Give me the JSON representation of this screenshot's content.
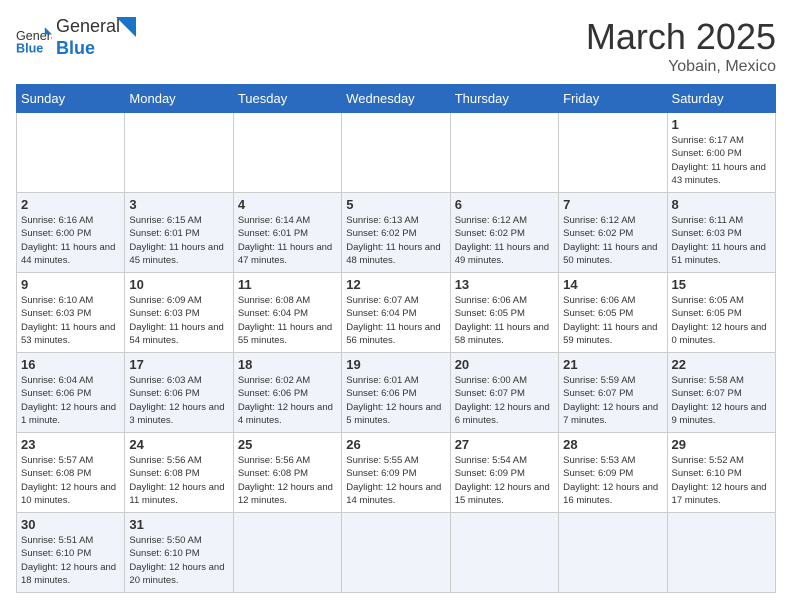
{
  "header": {
    "logo_text_normal": "General",
    "logo_text_blue": "Blue",
    "month_title": "March 2025",
    "subtitle": "Yobain, Mexico"
  },
  "days_of_week": [
    "Sunday",
    "Monday",
    "Tuesday",
    "Wednesday",
    "Thursday",
    "Friday",
    "Saturday"
  ],
  "weeks": [
    [
      null,
      null,
      null,
      null,
      null,
      null,
      {
        "day": 1,
        "sunrise": "6:17 AM",
        "sunset": "6:00 PM",
        "daylight": "11 hours and 43 minutes."
      }
    ],
    [
      {
        "day": 2,
        "sunrise": "6:16 AM",
        "sunset": "6:00 PM",
        "daylight": "11 hours and 44 minutes."
      },
      {
        "day": 3,
        "sunrise": "6:15 AM",
        "sunset": "6:01 PM",
        "daylight": "11 hours and 45 minutes."
      },
      {
        "day": 4,
        "sunrise": "6:14 AM",
        "sunset": "6:01 PM",
        "daylight": "11 hours and 47 minutes."
      },
      {
        "day": 5,
        "sunrise": "6:13 AM",
        "sunset": "6:02 PM",
        "daylight": "11 hours and 48 minutes."
      },
      {
        "day": 6,
        "sunrise": "6:12 AM",
        "sunset": "6:02 PM",
        "daylight": "11 hours and 49 minutes."
      },
      {
        "day": 7,
        "sunrise": "6:12 AM",
        "sunset": "6:02 PM",
        "daylight": "11 hours and 50 minutes."
      },
      {
        "day": 8,
        "sunrise": "6:11 AM",
        "sunset": "6:03 PM",
        "daylight": "11 hours and 51 minutes."
      }
    ],
    [
      {
        "day": 9,
        "sunrise": "6:10 AM",
        "sunset": "6:03 PM",
        "daylight": "11 hours and 53 minutes."
      },
      {
        "day": 10,
        "sunrise": "6:09 AM",
        "sunset": "6:03 PM",
        "daylight": "11 hours and 54 minutes."
      },
      {
        "day": 11,
        "sunrise": "6:08 AM",
        "sunset": "6:04 PM",
        "daylight": "11 hours and 55 minutes."
      },
      {
        "day": 12,
        "sunrise": "6:07 AM",
        "sunset": "6:04 PM",
        "daylight": "11 hours and 56 minutes."
      },
      {
        "day": 13,
        "sunrise": "6:06 AM",
        "sunset": "6:05 PM",
        "daylight": "11 hours and 58 minutes."
      },
      {
        "day": 14,
        "sunrise": "6:06 AM",
        "sunset": "6:05 PM",
        "daylight": "11 hours and 59 minutes."
      },
      {
        "day": 15,
        "sunrise": "6:05 AM",
        "sunset": "6:05 PM",
        "daylight": "12 hours and 0 minutes."
      }
    ],
    [
      {
        "day": 16,
        "sunrise": "6:04 AM",
        "sunset": "6:06 PM",
        "daylight": "12 hours and 1 minute."
      },
      {
        "day": 17,
        "sunrise": "6:03 AM",
        "sunset": "6:06 PM",
        "daylight": "12 hours and 3 minutes."
      },
      {
        "day": 18,
        "sunrise": "6:02 AM",
        "sunset": "6:06 PM",
        "daylight": "12 hours and 4 minutes."
      },
      {
        "day": 19,
        "sunrise": "6:01 AM",
        "sunset": "6:06 PM",
        "daylight": "12 hours and 5 minutes."
      },
      {
        "day": 20,
        "sunrise": "6:00 AM",
        "sunset": "6:07 PM",
        "daylight": "12 hours and 6 minutes."
      },
      {
        "day": 21,
        "sunrise": "5:59 AM",
        "sunset": "6:07 PM",
        "daylight": "12 hours and 7 minutes."
      },
      {
        "day": 22,
        "sunrise": "5:58 AM",
        "sunset": "6:07 PM",
        "daylight": "12 hours and 9 minutes."
      }
    ],
    [
      {
        "day": 23,
        "sunrise": "5:57 AM",
        "sunset": "6:08 PM",
        "daylight": "12 hours and 10 minutes."
      },
      {
        "day": 24,
        "sunrise": "5:56 AM",
        "sunset": "6:08 PM",
        "daylight": "12 hours and 11 minutes."
      },
      {
        "day": 25,
        "sunrise": "5:56 AM",
        "sunset": "6:08 PM",
        "daylight": "12 hours and 12 minutes."
      },
      {
        "day": 26,
        "sunrise": "5:55 AM",
        "sunset": "6:09 PM",
        "daylight": "12 hours and 14 minutes."
      },
      {
        "day": 27,
        "sunrise": "5:54 AM",
        "sunset": "6:09 PM",
        "daylight": "12 hours and 15 minutes."
      },
      {
        "day": 28,
        "sunrise": "5:53 AM",
        "sunset": "6:09 PM",
        "daylight": "12 hours and 16 minutes."
      },
      {
        "day": 29,
        "sunrise": "5:52 AM",
        "sunset": "6:10 PM",
        "daylight": "12 hours and 17 minutes."
      }
    ],
    [
      {
        "day": 30,
        "sunrise": "5:51 AM",
        "sunset": "6:10 PM",
        "daylight": "12 hours and 18 minutes."
      },
      {
        "day": 31,
        "sunrise": "5:50 AM",
        "sunset": "6:10 PM",
        "daylight": "12 hours and 20 minutes."
      },
      null,
      null,
      null,
      null,
      null
    ]
  ]
}
